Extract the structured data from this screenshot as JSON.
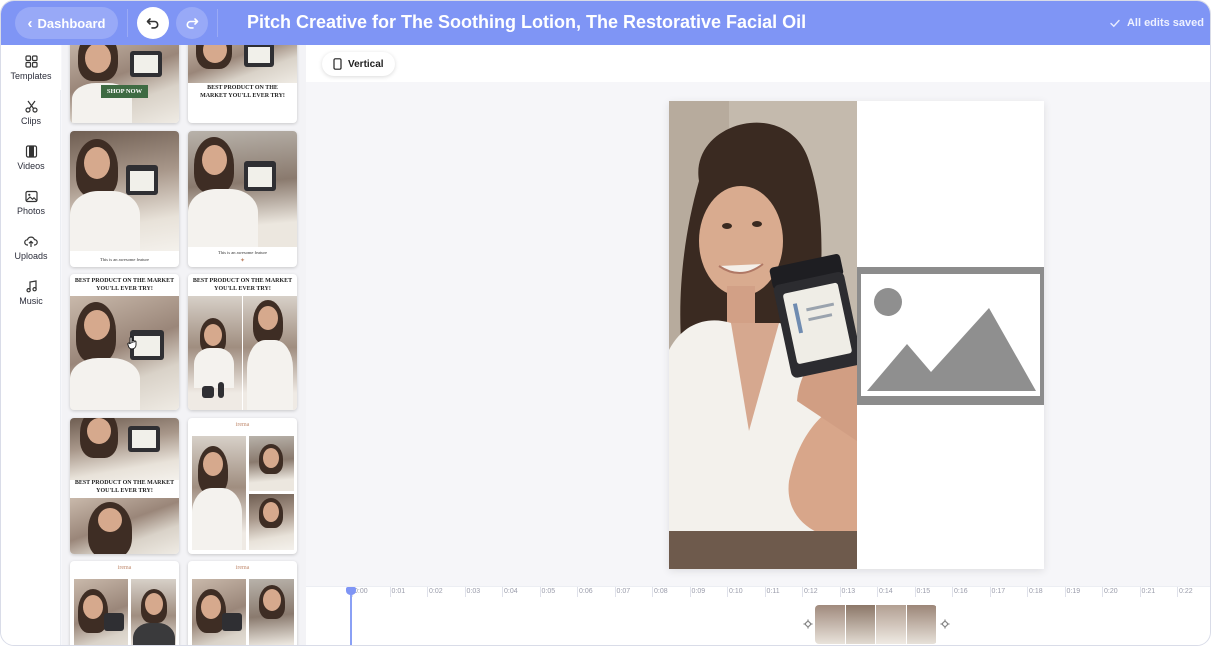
{
  "header": {
    "back_label": "Dashboard",
    "title": "Pitch Creative for The Soothing Lotion, The Restorative Facial Oil",
    "save_status": "All edits saved",
    "colors": {
      "bar": "#7f95f5",
      "button": "#98a9f7"
    }
  },
  "rail": {
    "items": [
      {
        "label": "Templates",
        "icon": "templates-icon"
      },
      {
        "label": "Clips",
        "icon": "scissors-icon"
      },
      {
        "label": "Videos",
        "icon": "film-icon"
      },
      {
        "label": "Photos",
        "icon": "image-icon"
      },
      {
        "label": "Uploads",
        "icon": "cloud-upload-icon"
      },
      {
        "label": "Music",
        "icon": "music-icon"
      }
    ]
  },
  "templates": {
    "shop_now": "SHOP NOW",
    "best_product": "BEST PRODUCT ON THE MARKET YOU'LL EVER TRY!",
    "awesome_feature": "This is an awesome feature",
    "brand": "irema"
  },
  "editor": {
    "orientation_label": "Vertical"
  },
  "timeline": {
    "ticks": [
      "0:00",
      "0:01",
      "0:02",
      "0:03",
      "0:04",
      "0:05",
      "0:06",
      "0:07",
      "0:08",
      "0:09",
      "0:10",
      "0:11",
      "0:12",
      "0:13",
      "0:14",
      "0:15",
      "0:16",
      "0:17",
      "0:18",
      "0:19",
      "0:20",
      "0:21",
      "0:22"
    ]
  }
}
